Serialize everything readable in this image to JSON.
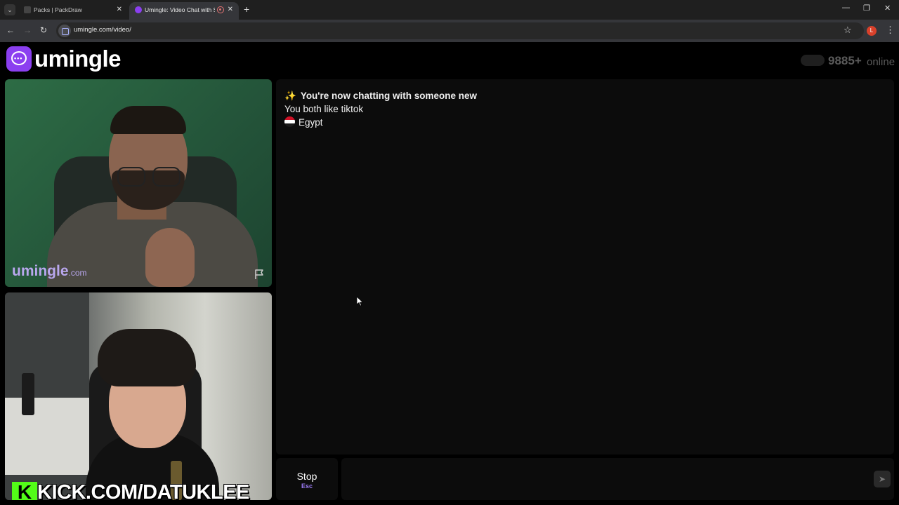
{
  "browser": {
    "tabs": [
      {
        "title": "Packs | PackDraw",
        "active": false
      },
      {
        "title": "Umingle: Video Chat with S",
        "active": true
      }
    ],
    "url": "umingle.com/video/",
    "profile_initial": "L"
  },
  "header": {
    "logo_text": "umingle",
    "online_count": "9885+",
    "online_label": "online"
  },
  "video": {
    "stranger_watermark": "umingle",
    "stranger_watermark_suffix": ".com",
    "self_overlay_text": "KICK.COM/DATUKLEE",
    "self_overlay_logo": "K"
  },
  "chat": {
    "messages": [
      {
        "icon": "sparkles-icon",
        "text": "You're now chatting with someone new"
      },
      {
        "text": "You both like tiktok"
      },
      {
        "icon": "egypt-flag-icon",
        "text": "Egypt"
      }
    ]
  },
  "controls": {
    "stop_label": "Stop",
    "stop_shortcut": "Esc",
    "input_placeholder": ""
  },
  "colors": {
    "brand": "#8b3ff0",
    "watermark": "#b9a7ee",
    "kick_green": "#53fc18",
    "shortcut": "#9c7bf5"
  }
}
